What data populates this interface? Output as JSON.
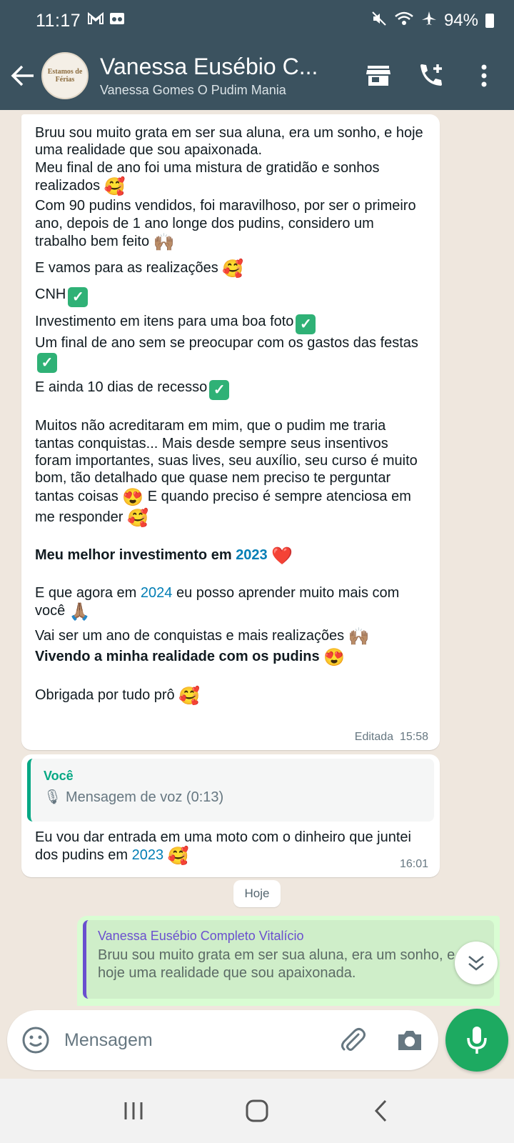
{
  "status_bar": {
    "time": "11:17",
    "battery": "94%"
  },
  "header": {
    "avatar_text": "Estamos de Férias",
    "title": "Vanessa Eusébio C...",
    "subtitle": "Vanessa Gomes O Pudim Mania"
  },
  "messages": {
    "m1": {
      "l1": "Bruu sou muito grata em ser sua aluna, era um sonho, e hoje uma realidade que sou apaixonada.",
      "l2": "Meu final de ano foi uma mistura de gratidão e sonhos realizados",
      "l3": "Com 90 pudins vendidos, foi maravilhoso, por ser o primeiro ano, depois de 1 ano longe dos pudins, considero um trabalho bem feito",
      "l4": "E vamos para as realizações",
      "l5": "CNH",
      "l6": "Investimento em itens para uma boa foto",
      "l7": "Um final de ano sem se preocupar com os gastos das festas",
      "l8": "E ainda 10 dias de recesso",
      "l9": "Muitos não acreditaram em mim, que o pudim me traria tantas conquistas... Mais desde sempre seus insentivos foram importantes, suas lives, seu auxílio, seu curso é muito bom, tão detalhado que quase nem preciso te perguntar tantas coisas",
      "l9b": "E quando preciso é sempre atenciosa em me responder",
      "l10a": "Meu melhor investimento em",
      "l10b": "2023",
      "l11a": "E que agora em",
      "l11b": "2024",
      "l11c": "eu posso aprender muito mais com você",
      "l12": "Vai ser um ano de conquistas e mais realizações",
      "l13": "Vivendo a minha realidade com os pudins",
      "l14": "Obrigada por tudo prô",
      "edited": "Editada",
      "time": "15:58"
    },
    "m2": {
      "quote_author": "Você",
      "quote_text": "Mensagem de voz (0:13)",
      "text_a": "Eu vou dar entrada em uma moto com o dinheiro que juntei dos pudins em",
      "text_b": "2023",
      "time": "16:01"
    },
    "date_divider": "Hoje",
    "m3": {
      "quote_author": "Vanessa Eusébio Completo Vitalício",
      "quote_text": "Bruu sou muito grata em ser sua aluna, era um sonho, e hoje uma realidade que sou apaixonada."
    }
  },
  "input": {
    "placeholder": "Mensagem"
  },
  "colors": {
    "header": "#3b525f",
    "accent": "#1daa61",
    "link": "#027eb5",
    "outgoing": "#d9fdd3"
  },
  "icons": [
    "back-arrow-icon",
    "store-icon",
    "add-call-icon",
    "more-vert-icon",
    "emoji-icon",
    "attach-icon",
    "camera-icon",
    "mic-icon",
    "chevron-down-icon"
  ]
}
